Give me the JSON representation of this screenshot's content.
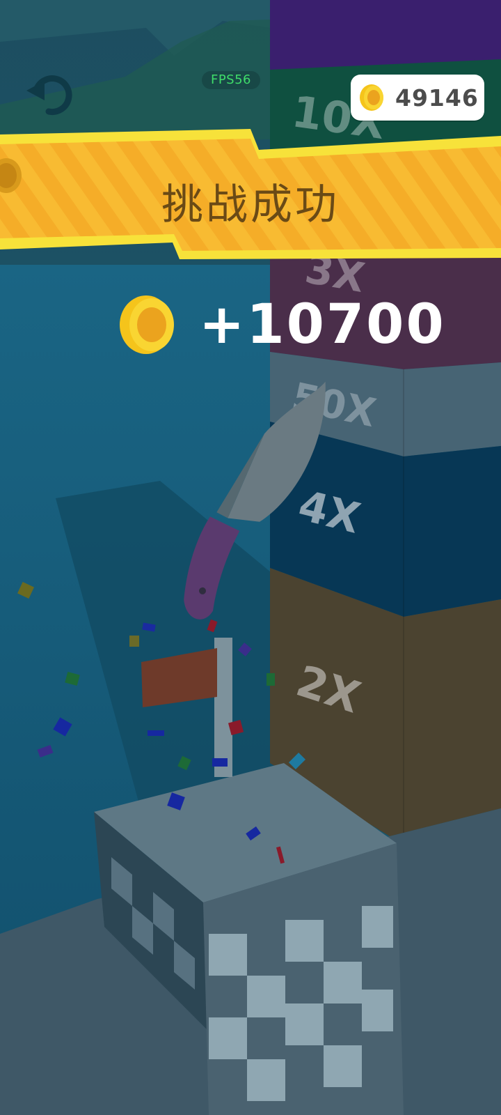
{
  "hud": {
    "fps_label": "FPS56",
    "coin_total": "49146",
    "restart_icon": "restart-arrow-icon"
  },
  "banner": {
    "title": "挑战成功"
  },
  "reward": {
    "amount_text": "+10700",
    "icon": "gold-coin-icon"
  },
  "tower": {
    "multipliers": [
      "10X",
      "3X",
      "50X",
      "4X",
      "2X"
    ],
    "colors": {
      "top": "#3a1f6e",
      "ten": "#0f5040",
      "three": "#4a2e4a",
      "fifty": "#476474",
      "four": "#073755",
      "two": "#4b4330"
    }
  },
  "colors": {
    "banner": "#f5b32a",
    "banner_edge": "#f7e23a",
    "coin": "#f5c41b",
    "water": "#155873",
    "fps_text": "#3fdc6a"
  }
}
